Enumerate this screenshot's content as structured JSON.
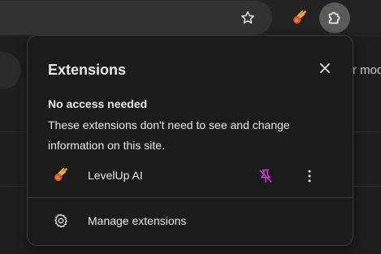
{
  "toolbar": {
    "star_icon": "star-icon",
    "extension_icon": "comet-icon",
    "puzzle_icon": "puzzle-icon"
  },
  "page": {
    "partial_text": "r mod"
  },
  "popup": {
    "title": "Extensions",
    "close_icon": "close-icon",
    "section_heading": "No access needed",
    "section_desc": "These extensions don't need to see and change information on this site.",
    "extensions": [
      {
        "name": "LevelUp AI",
        "icon": "comet-icon",
        "pin_state": "unpinned",
        "pin_color": "#d634d8"
      }
    ],
    "manage_label": "Manage extensions",
    "manage_icon": "gear-icon"
  },
  "colors": {
    "popup_bg": "#1a1c1a",
    "text": "#e6e8e5",
    "puzzle_active_bg": "#575c57",
    "pin_accent": "#d634d8"
  }
}
